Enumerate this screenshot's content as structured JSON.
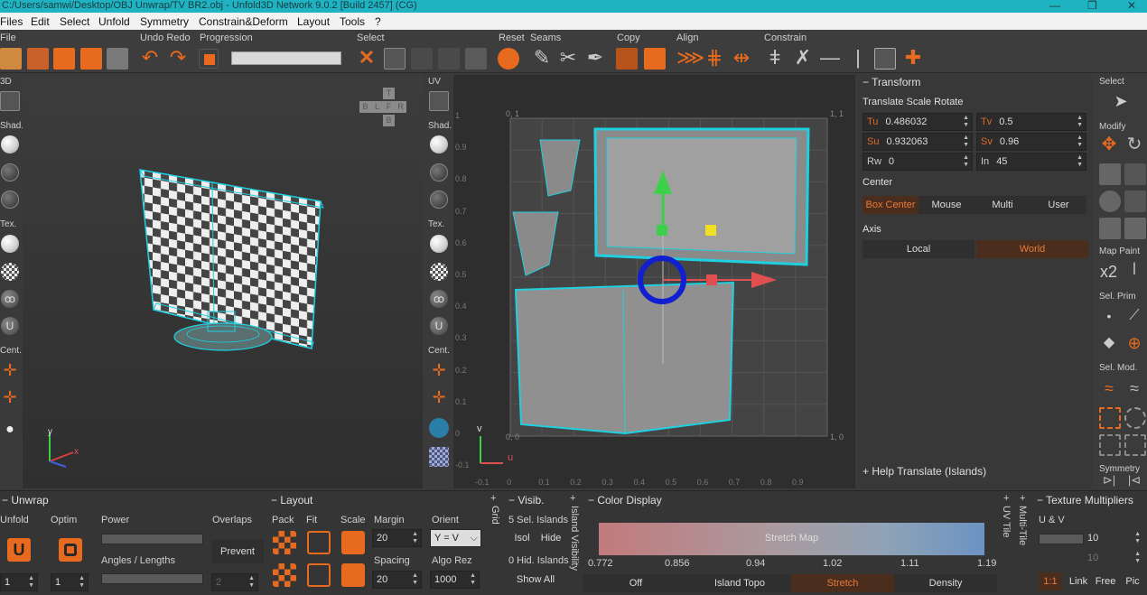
{
  "window": {
    "title": "C:/Users/samwi/Desktop/OBJ Unwrap/TV BR2.obj - Unfold3D Network 9.0.2 [Build 2457] (CG)",
    "min": "—",
    "max": "❐",
    "close": "✕"
  },
  "menu": [
    "Files",
    "Edit",
    "Select",
    "Unfold",
    "Symmetry",
    "Constrain&Deform",
    "Layout",
    "Tools",
    "?"
  ],
  "toolbar": {
    "groups": {
      "file": "File",
      "undo_redo": "Undo Redo",
      "progression": "Progression",
      "select": "Select",
      "reset": "Reset",
      "seams": "Seams",
      "copy": "Copy",
      "align": "Align",
      "constrain": "Constrain"
    }
  },
  "left3d": {
    "label_3d": "3D",
    "shad": "Shad.",
    "tex": "Tex.",
    "cent": "Cent."
  },
  "viewcube": [
    "T",
    "B",
    "L",
    "F",
    "R",
    "B"
  ],
  "axis3d": {
    "x": "x",
    "y": "y"
  },
  "uvside": {
    "label_uv": "UV",
    "shad": "Shad.",
    "tex": "Tex.",
    "cent": "Cent."
  },
  "uvgrid": {
    "y_ticks": [
      "1",
      "0.9",
      "0.8",
      "0.7",
      "0.6",
      "0.5",
      "0.4",
      "0.3",
      "0.2",
      "0.1",
      "0",
      "-0.1"
    ],
    "x_ticks": [
      "-0.1",
      "0",
      "0.1",
      "0.2",
      "0.3",
      "0.4",
      "0.5",
      "0.6",
      "0.7",
      "0.8",
      "0.9"
    ],
    "corner_tl": "0, 1",
    "corner_tr": "1, 1",
    "corner_bl": "0, 0",
    "corner_br": "1, 0",
    "axis_u": "u",
    "axis_v": "v"
  },
  "transform": {
    "header": "Transform",
    "sub": "Translate Scale Rotate",
    "tu_label": "Tu",
    "tu": "0.486032",
    "tv_label": "Tv",
    "tv": "0.5",
    "su_label": "Su",
    "su": "0.932063",
    "sv_label": "Sv",
    "sv": "0.96",
    "rw_label": "Rw",
    "rw": "0",
    "in_label": "In",
    "in": "45",
    "center_label": "Center",
    "center_opts": [
      "Box Center",
      "Mouse",
      "Multi",
      "User"
    ],
    "axis_label": "Axis",
    "axis_opts": [
      "Local",
      "World"
    ],
    "help": "Help Translate (Islands)"
  },
  "toolcol": {
    "select": "Select",
    "modify": "Modify",
    "map_paint": "Map Paint",
    "sel_prim": "Sel. Prim",
    "sel_mod": "Sel. Mod.",
    "symmetry": "Symmetry",
    "x2": "x2"
  },
  "unwrap": {
    "header": "Unwrap",
    "unfold": "Unfold",
    "optim": "Optim",
    "power": "Power",
    "angles": "Angles / Lengths",
    "unfold_val": "1",
    "optim_val": "1",
    "power_val": "2"
  },
  "overlaps": {
    "label": "Overlaps",
    "prevent": "Prevent"
  },
  "layout": {
    "header": "Layout",
    "pack": "Pack",
    "fit": "Fit",
    "scale": "Scale",
    "margin": "Margin",
    "margin_val": "20",
    "spacing": "Spacing",
    "spacing_val": "20",
    "orient": "Orient",
    "orient_val": "Y = V",
    "algo": "Algo Rez",
    "algo_val": "1000",
    "grid": "Grid"
  },
  "visib": {
    "header": "Visib.",
    "sel_islands": "5 Sel. Islands",
    "isol": "Isol",
    "hide": "Hide",
    "hid_islands": "0 Hid. Islands",
    "show_all": "Show All",
    "island_vis": "Island Visibility"
  },
  "color_display": {
    "header": "Color Display",
    "bar_label": "Stretch Map",
    "ticks": [
      "0.772",
      "0.856",
      "0.94",
      "1.02",
      "1.11",
      "1.19"
    ],
    "modes": [
      "Off",
      "Island Topo",
      "Stretch",
      "Density"
    ],
    "uv_tile": "UV Tile",
    "multi_tile": "Multi-Tile"
  },
  "texture_mult": {
    "header": "Texture Multipliers",
    "uv": "U & V",
    "u_val": "10",
    "v_val": "10",
    "ratio": "1:1",
    "opts": [
      "Link",
      "Free",
      "Pic"
    ]
  },
  "colors": {
    "accent": "#e86a1f",
    "cyan": "#1fd0e0",
    "title": "#1fb3c2"
  }
}
